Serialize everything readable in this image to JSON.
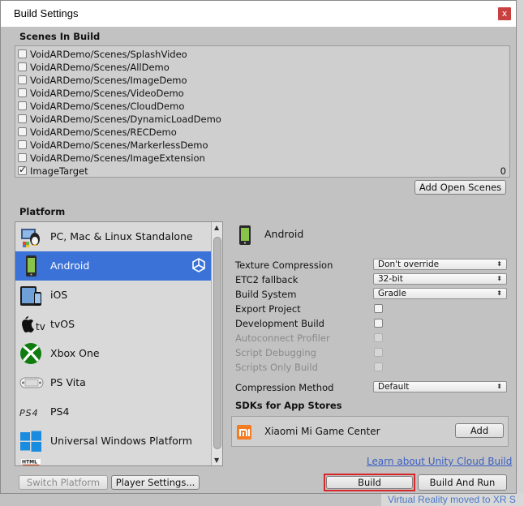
{
  "window": {
    "title": "Build Settings",
    "close_glyph": "x"
  },
  "scenes": {
    "section_title": "Scenes In Build",
    "items": [
      {
        "label": "VoidARDemo/Scenes/SplashVideo",
        "checked": false,
        "index": ""
      },
      {
        "label": "VoidARDemo/Scenes/AllDemo",
        "checked": false,
        "index": ""
      },
      {
        "label": "VoidARDemo/Scenes/ImageDemo",
        "checked": false,
        "index": ""
      },
      {
        "label": "VoidARDemo/Scenes/VideoDemo",
        "checked": false,
        "index": ""
      },
      {
        "label": "VoidARDemo/Scenes/CloudDemo",
        "checked": false,
        "index": ""
      },
      {
        "label": "VoidARDemo/Scenes/DynamicLoadDemo",
        "checked": false,
        "index": ""
      },
      {
        "label": "VoidARDemo/Scenes/RECDemo",
        "checked": false,
        "index": ""
      },
      {
        "label": "VoidARDemo/Scenes/MarkerlessDemo",
        "checked": false,
        "index": ""
      },
      {
        "label": "VoidARDemo/Scenes/ImageExtension",
        "checked": false,
        "index": ""
      },
      {
        "label": "ImageTarget",
        "checked": true,
        "index": "0"
      }
    ],
    "add_open_scenes_label": "Add Open Scenes"
  },
  "platform": {
    "section_title": "Platform",
    "items": [
      {
        "label": "PC, Mac & Linux Standalone",
        "icon": "pc-mac-linux-icon",
        "selected": false
      },
      {
        "label": "Android",
        "icon": "android-icon",
        "selected": true
      },
      {
        "label": "iOS",
        "icon": "ios-icon",
        "selected": false
      },
      {
        "label": "tvOS",
        "icon": "tvos-icon",
        "selected": false
      },
      {
        "label": "Xbox One",
        "icon": "xbox-icon",
        "selected": false
      },
      {
        "label": "PS Vita",
        "icon": "ps-vita-icon",
        "selected": false
      },
      {
        "label": "PS4",
        "icon": "ps4-icon",
        "selected": false
      },
      {
        "label": "Universal Windows Platform",
        "icon": "windows-icon",
        "selected": false
      },
      {
        "label": "",
        "icon": "html5-icon",
        "selected": false
      }
    ],
    "ps4_logo_text": "PS4",
    "tv_logo_text": "tv",
    "html_logo_text": "HTML"
  },
  "settings": {
    "platform_name": "Android",
    "texture_compression": {
      "label": "Texture Compression",
      "value": "Don't override"
    },
    "etc2_fallback": {
      "label": "ETC2 fallback",
      "value": "32-bit"
    },
    "build_system": {
      "label": "Build System",
      "value": "Gradle"
    },
    "export_project": {
      "label": "Export Project",
      "checked": false
    },
    "development_build": {
      "label": "Development Build",
      "checked": false
    },
    "autoconnect_profiler": {
      "label": "Autoconnect Profiler",
      "checked": false,
      "disabled": true
    },
    "script_debugging": {
      "label": "Script Debugging",
      "checked": false,
      "disabled": true
    },
    "scripts_only_build": {
      "label": "Scripts Only Build",
      "checked": false,
      "disabled": true
    },
    "compression_method": {
      "label": "Compression Method",
      "value": "Default"
    },
    "sdks_title": "SDKs for App Stores",
    "sdk_item": {
      "label": "Xiaomi Mi Game Center",
      "add_label": "Add"
    },
    "cloud_build_link": "Learn about Unity Cloud Build"
  },
  "footer": {
    "switch_platform": "Switch Platform",
    "player_settings": "Player Settings...",
    "build": "Build",
    "build_and_run": "Build And Run"
  },
  "background": {
    "bottom_link": "Virtual Reality moved to XR S"
  },
  "colors": {
    "selection": "#3a72d8",
    "build_highlight": "#d9262b",
    "link": "#3a5fc4"
  }
}
